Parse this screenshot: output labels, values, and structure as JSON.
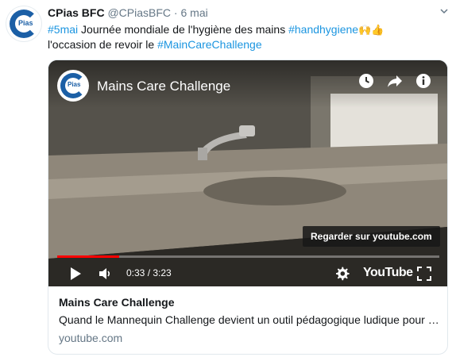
{
  "author": {
    "display_name": "CPias BFC",
    "handle": "@CPiasBFC",
    "separator": "·",
    "date": "6 mai",
    "avatar_wordmark": "Pias"
  },
  "tweet": {
    "line1_hashtag1": "#5mai",
    "line1_text": " Journée mondiale de l'hygiène des mains ",
    "line1_hashtag2": "#handhygiene",
    "line1_emoji": "🙌👍",
    "line2_text": "l'occasion de revoir le ",
    "line2_hashtag": "#MainCareChallenge"
  },
  "video": {
    "title": "Mains Care Challenge",
    "channel_wordmark": "Pias",
    "watch_on": "Regarder sur youtube.com",
    "current_time": "0:33",
    "time_separator": " / ",
    "duration": "3:23",
    "progress": 0.163,
    "platform": "YouTube",
    "icons": [
      "clock-icon",
      "share-icon",
      "info-icon",
      "play-icon",
      "volume-icon",
      "settings-icon",
      "fullscreen-icon"
    ]
  },
  "card": {
    "title": "Mains Care Challenge",
    "description": "Quand le Mannequin Challenge devient un outil pédagogique ludique pour les soignants",
    "domain": "youtube.com"
  },
  "colors": {
    "link": "#1b95e0",
    "muted": "#657786",
    "progress": "#ff0000",
    "brand_blue": "#1b5fa6"
  }
}
